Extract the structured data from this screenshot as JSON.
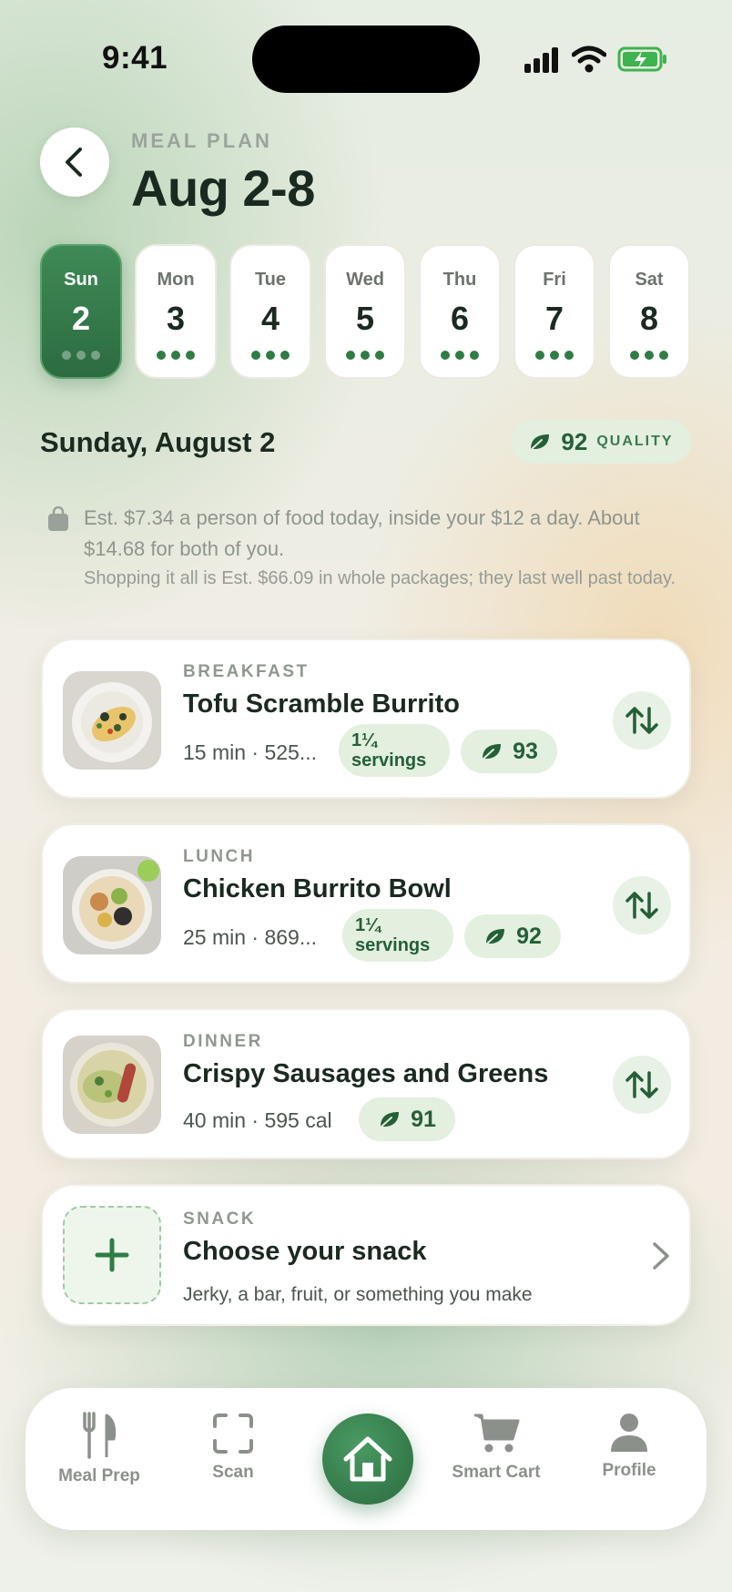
{
  "status_bar": {
    "time": "9:41"
  },
  "header": {
    "eyebrow": "MEAL PLAN",
    "title": "Aug 2-8"
  },
  "days": [
    {
      "name": "Sun",
      "num": "2",
      "active": true
    },
    {
      "name": "Mon",
      "num": "3",
      "active": false
    },
    {
      "name": "Tue",
      "num": "4",
      "active": false
    },
    {
      "name": "Wed",
      "num": "5",
      "active": false
    },
    {
      "name": "Thu",
      "num": "6",
      "active": false
    },
    {
      "name": "Fri",
      "num": "7",
      "active": false
    },
    {
      "name": "Sat",
      "num": "8",
      "active": false
    }
  ],
  "selected_day": {
    "heading": "Sunday, August 2",
    "quality_score": "92",
    "quality_label": "QUALITY"
  },
  "budget": {
    "line1": "Est. $7.34 a person of food today, inside your $12 a day. About $14.68 for both of you.",
    "line2": "Shopping it all is Est. $66.09 in whole packages; they last well past today."
  },
  "meals": [
    {
      "type": "BREAKFAST",
      "name": "Tofu Scramble Burrito",
      "meta": "15 min · 525...",
      "servings": "1¼ servings",
      "score": "93"
    },
    {
      "type": "LUNCH",
      "name": "Chicken Burrito Bowl",
      "meta": "25 min · 869...",
      "servings": "1¼ servings",
      "score": "92"
    },
    {
      "type": "DINNER",
      "name": "Crispy Sausages and Greens",
      "meta": "40 min · 595 cal",
      "score": "91"
    }
  ],
  "snack": {
    "type": "SNACK",
    "title": "Choose your snack",
    "subtitle": "Jerky, a bar, fruit, or something you make"
  },
  "nav": {
    "meal_prep": "Meal Prep",
    "scan": "Scan",
    "smart_cart": "Smart Cart",
    "profile": "Profile"
  },
  "colors": {
    "accent": "#2f7d45",
    "pill": "#e3efdf"
  }
}
